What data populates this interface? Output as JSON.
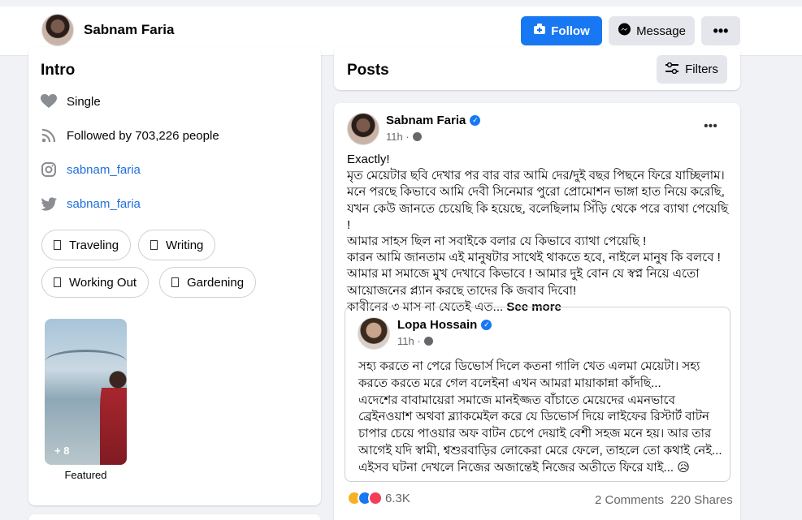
{
  "header": {
    "profile_name": "Sabnam Faria",
    "follow_label": "Follow",
    "message_label": "Message",
    "more_label": "•••"
  },
  "intro": {
    "title": "Intro",
    "relationship": "Single",
    "followed_by_prefix": "Followed by ",
    "followed_by_count": "703,226",
    "followed_by_suffix": " people",
    "instagram": "sabnam_faria",
    "twitter": "sabnam_faria",
    "hobbies": [
      "Traveling",
      "Writing",
      "Working Out",
      "Gardening"
    ],
    "featured_count": "+ 8",
    "featured_label": "Featured"
  },
  "posts": {
    "title": "Posts",
    "filters_label": "Filters"
  },
  "post": {
    "author": "Sabnam Faria",
    "time": "11h ·",
    "more_label": "•••",
    "text": "Exactly!\nমৃত মেয়েটার ছবি দেখার পর বার বার আমি দের/দুই বছর পিছনে ফিরে যাচ্ছিলাম।\nমনে পরছে কিভাবে আমি দেবী সিনেমার পুরো প্রোমোশন ভাঙ্গা হাত নিয়ে করেছি, যখন কেউ জানতে চেয়েছি কি হয়েছে, বলেছিলাম সিঁড়ি থেকে পরে ব্যাথা পেয়েছি !\nআমার সাহস ছিল না সবাইকে বলার যে কিভাবে ব্যাথা পেয়েছি !\nকারন আমি জানতাম এই মানুষটার সাথেই থাকতে হবে, নাইলে মানুষ কি বলবে ! আমার মা সমাজে মুখ দেখাবে কিভাবে ! আমার দুই বোন যে স্বপ্ন নিয়ে এতো আয়োজনের প্ল্যান করছে তাদের কি জবাব দিবো!\nকাবীনের ৩ মাস না যেতেই এত...",
    "see_more": "See more",
    "shared": {
      "author": "Lopa Hossain",
      "time": "11h ·",
      "text": "সহ্য করতে না পেরে ডিভোর্স দিলে কতনা গালি খেত এলমা  মেয়েটা। সহ্য করতে করতে মরে গেল বলেইনা এখন আমরা মায়াকান্না কাঁদছি...\nএদেশের বাবামায়েরা সমাজে মানইজ্জত বাঁচাতে মেয়েদের এমনভাবে ব্রেইনওয়াশ অথবা ব্ল্যাকমেইল করে যে ডিভোর্স দিয়ে লাইফের রিস্টার্ট বাটন চাপার চেয়ে পাওয়ার অফ বাটন চেপে দেয়াই বেশী সহজ মনে হয়। আর তার আগেই যদি স্বামী, শ্বশুরবাড়ির লোকেরা মেরে ফেলে, তাহলে তো কথাই নেই...\nএইসব ঘটনা দেখলে নিজের অজান্তেই নিজের অতীতে ফিরে যাই... 😥"
    },
    "reaction_count": "6.3K",
    "comments": "2 Comments",
    "shares": "220 Shares"
  },
  "colors": {
    "accent": "#1877f2",
    "link": "#216fdb",
    "background": "#f0f2f5"
  }
}
